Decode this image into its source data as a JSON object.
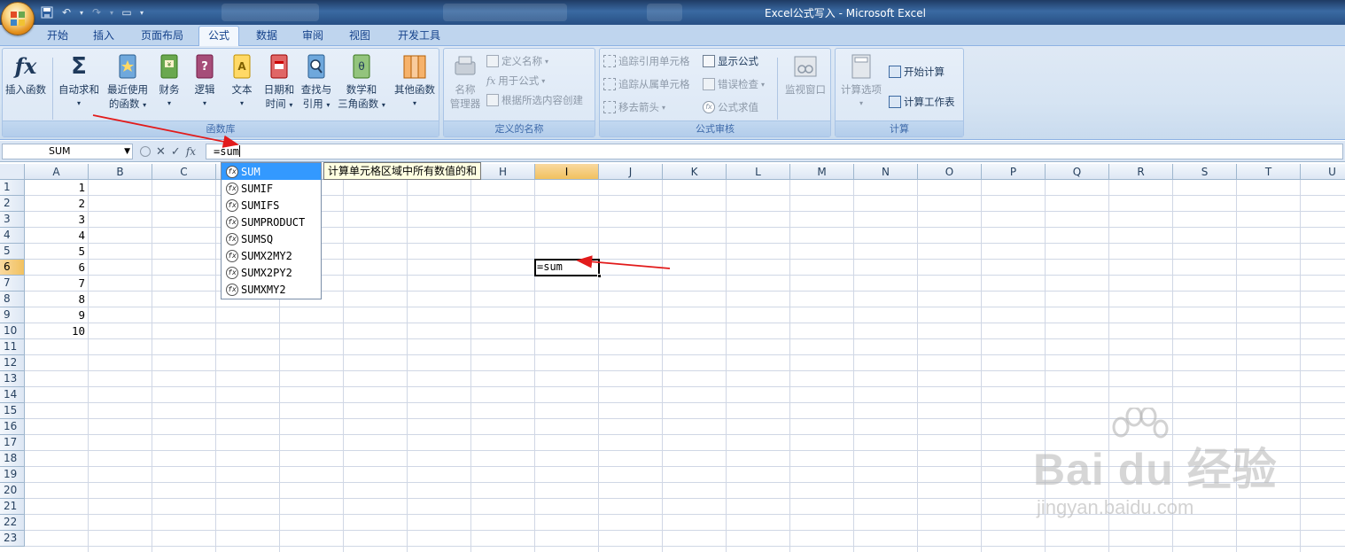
{
  "window": {
    "title": "Excel公式写入 - Microsoft Excel"
  },
  "tabs": [
    {
      "label": "开始"
    },
    {
      "label": "插入"
    },
    {
      "label": "页面布局"
    },
    {
      "label": "公式"
    },
    {
      "label": "数据"
    },
    {
      "label": "审阅"
    },
    {
      "label": "视图"
    },
    {
      "label": "开发工具"
    }
  ],
  "active_tab": "公式",
  "ribbon": {
    "function_library": {
      "label": "函数库",
      "insert_function": "插入函数",
      "autosum": "自动求和",
      "recent_1": "最近使用",
      "recent_2": "的函数",
      "financial": "财务",
      "logical": "逻辑",
      "text": "文本",
      "datetime_1": "日期和",
      "datetime_2": "时间",
      "lookup_1": "查找与",
      "lookup_2": "引用",
      "math_1": "数学和",
      "math_2": "三角函数",
      "more": "其他函数"
    },
    "defined_names": {
      "label": "定义的名称",
      "name_manager_1": "名称",
      "name_manager_2": "管理器",
      "define_name": "定义名称",
      "use_in_formula": "用于公式",
      "create_from_selection": "根据所选内容创建"
    },
    "formula_auditing": {
      "label": "公式审核",
      "trace_precedents": "追踪引用单元格",
      "trace_dependents": "追踪从属单元格",
      "remove_arrows": "移去箭头",
      "show_formulas": "显示公式",
      "error_checking": "错误检查",
      "evaluate_formula": "公式求值",
      "watch_window": "监视窗口"
    },
    "calculation": {
      "label": "计算",
      "calc_options": "计算选项",
      "calc_now": "开始计算",
      "calc_sheet": "计算工作表"
    }
  },
  "formula_bar": {
    "name_box": "SUM",
    "formula": "=sum"
  },
  "columns": [
    "A",
    "B",
    "C",
    "D",
    "E",
    "F",
    "G",
    "H",
    "I",
    "J",
    "K",
    "L",
    "M",
    "N",
    "O",
    "P",
    "Q",
    "R",
    "S",
    "T",
    "U"
  ],
  "selected_column": "I",
  "rows": [
    "1",
    "2",
    "3",
    "4",
    "5",
    "6",
    "7",
    "8",
    "9",
    "10",
    "11",
    "12",
    "13",
    "14",
    "15",
    "16",
    "17",
    "18",
    "19",
    "20",
    "21",
    "22",
    "23"
  ],
  "selected_row": "6",
  "column_a_values": [
    "1",
    "2",
    "3",
    "4",
    "5",
    "6",
    "7",
    "8",
    "9",
    "10"
  ],
  "active_cell": {
    "ref": "I6",
    "content": "=sum"
  },
  "autocomplete": {
    "items": [
      "SUM",
      "SUMIF",
      "SUMIFS",
      "SUMPRODUCT",
      "SUMSQ",
      "SUMX2MY2",
      "SUMX2PY2",
      "SUMXMY2"
    ],
    "selected": "SUM",
    "tooltip": "计算单元格区域中所有数值的和"
  },
  "watermark": {
    "brand": "Bai du 经验",
    "url": "jingyan.baidu.com"
  },
  "colors": {
    "annotation": "#e21b1b",
    "selection": "#3399ff",
    "header_selected": "#f5c96a"
  }
}
